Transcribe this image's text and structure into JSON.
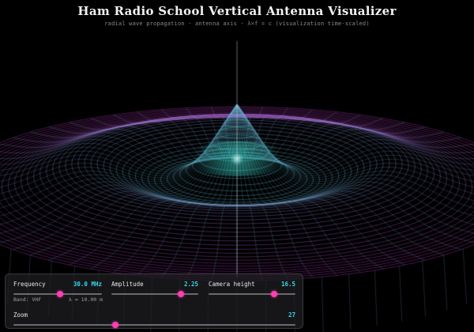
{
  "header": {
    "title": "Ham Radio School Vertical Antenna Visualizer",
    "subtitle": "radial wave propagation · antenna axis · λ×f = c (visualization time-scaled)"
  },
  "controls": {
    "frequency": {
      "label": "Frequency",
      "value": "30.0 MHz",
      "fraction": 0.53
    },
    "band": "Band: VHF",
    "wavelength": "λ = 10.00 m",
    "amplitude": {
      "label": "Amplitude",
      "value": "2.25",
      "fraction": 0.8
    },
    "camera_height": {
      "label": "Camera height",
      "value": "16.5",
      "fraction": 0.75
    },
    "zoom": {
      "label": "Zoom",
      "value": "27",
      "fraction": 0.36
    }
  },
  "colors": {
    "accent_value": "#38d6e8",
    "slider_thumb": "#ff3fb4",
    "wave_cyan": "#3fe6d8",
    "wave_magenta": "#c040c8",
    "background": "#000000"
  }
}
